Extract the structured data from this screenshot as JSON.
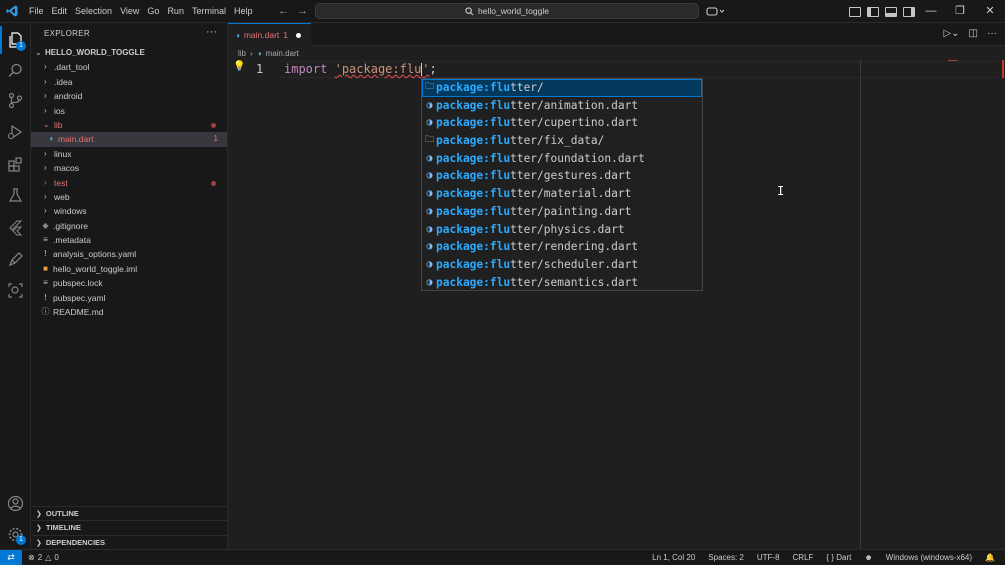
{
  "titlebar": {
    "menu": [
      "File",
      "Edit",
      "Selection",
      "View",
      "Go",
      "Run",
      "Terminal",
      "Help"
    ],
    "search": "hello_world_toggle"
  },
  "activity": {
    "explorer_badge": "1",
    "settings_badge": "1"
  },
  "sidebar": {
    "title": "EXPLORER",
    "project": "HELLO_WORLD_TOGGLE",
    "items": [
      {
        "label": ".dart_tool",
        "type": "folder"
      },
      {
        "label": ".idea",
        "type": "folder"
      },
      {
        "label": "android",
        "type": "folder"
      },
      {
        "label": "ios",
        "type": "folder"
      },
      {
        "label": "lib",
        "type": "folder-open"
      },
      {
        "label": "main.dart",
        "type": "dart",
        "count": "1"
      },
      {
        "label": "linux",
        "type": "folder"
      },
      {
        "label": "macos",
        "type": "folder"
      },
      {
        "label": "test",
        "type": "folder"
      },
      {
        "label": "web",
        "type": "folder"
      },
      {
        "label": "windows",
        "type": "folder"
      },
      {
        "label": ".gitignore",
        "type": "git"
      },
      {
        "label": ".metadata",
        "type": "text"
      },
      {
        "label": "analysis_options.yaml",
        "type": "yaml"
      },
      {
        "label": "hello_world_toggle.iml",
        "type": "iml"
      },
      {
        "label": "pubspec.lock",
        "type": "text"
      },
      {
        "label": "pubspec.yaml",
        "type": "yaml"
      },
      {
        "label": "README.md",
        "type": "info"
      }
    ],
    "sections": [
      "OUTLINE",
      "TIMELINE",
      "DEPENDENCIES"
    ]
  },
  "editor": {
    "tab_label": "main.dart",
    "tab_count": "1",
    "breadcrumb": [
      "lib",
      "main.dart"
    ],
    "line_number": "1",
    "code_keyword": "import",
    "code_string": "'package:flu",
    "code_string_end": "'",
    "code_semicolon": ";"
  },
  "suggestions": [
    {
      "match": "package:flu",
      "rest": "tter/",
      "icon": "folder-icon"
    },
    {
      "match": "package:flu",
      "rest": "tter/animation.dart",
      "icon": "dart-icon"
    },
    {
      "match": "package:flu",
      "rest": "tter/cupertino.dart",
      "icon": "dart-icon"
    },
    {
      "match": "package:flu",
      "rest": "tter/fix_data/",
      "icon": "folder-icon"
    },
    {
      "match": "package:flu",
      "rest": "tter/foundation.dart",
      "icon": "dart-icon"
    },
    {
      "match": "package:flu",
      "rest": "tter/gestures.dart",
      "icon": "dart-icon"
    },
    {
      "match": "package:flu",
      "rest": "tter/material.dart",
      "icon": "dart-icon"
    },
    {
      "match": "package:flu",
      "rest": "tter/painting.dart",
      "icon": "dart-icon"
    },
    {
      "match": "package:flu",
      "rest": "tter/physics.dart",
      "icon": "dart-icon"
    },
    {
      "match": "package:flu",
      "rest": "tter/rendering.dart",
      "icon": "dart-icon"
    },
    {
      "match": "package:flu",
      "rest": "tter/scheduler.dart",
      "icon": "dart-icon"
    },
    {
      "match": "package:flu",
      "rest": "tter/semantics.dart",
      "icon": "dart-icon"
    }
  ],
  "statusbar": {
    "errors": "2",
    "warnings": "0",
    "position": "Ln 1, Col 20",
    "spaces": "Spaces: 2",
    "encoding": "UTF-8",
    "eol": "CRLF",
    "language": "Dart",
    "device": "Windows (windows-x64)"
  },
  "colors": {
    "accent": "#0078d4",
    "error": "#f14c4c",
    "match": "#2aaaff"
  }
}
